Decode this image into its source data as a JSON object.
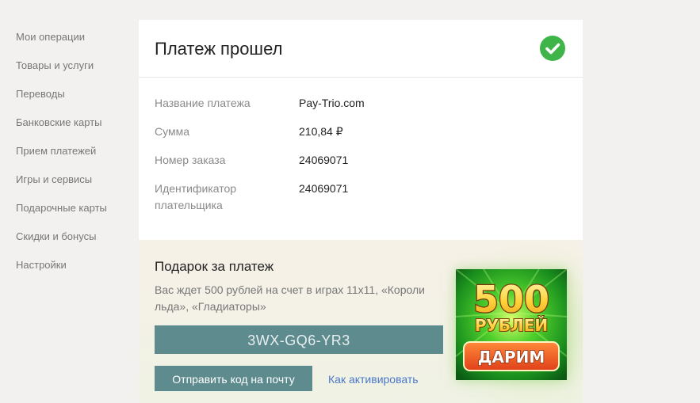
{
  "sidebar": {
    "items": [
      {
        "label": "Мои операции"
      },
      {
        "label": "Товары и услуги"
      },
      {
        "label": "Переводы"
      },
      {
        "label": "Банковские карты"
      },
      {
        "label": "Прием платежей"
      },
      {
        "label": "Игры и сервисы"
      },
      {
        "label": "Подарочные карты"
      },
      {
        "label": "Скидки и бонусы"
      },
      {
        "label": "Настройки"
      }
    ]
  },
  "payment": {
    "title": "Платеж прошел",
    "status_icon": "check-icon",
    "status_color": "#3fb549",
    "rows": [
      {
        "label": "Название платежа",
        "value": "Pay-Trio.com"
      },
      {
        "label": "Сумма",
        "value": "210,84 ₽"
      },
      {
        "label": "Номер заказа",
        "value": "24069071"
      },
      {
        "label": "Идентификатор плательщика",
        "value": "24069071"
      }
    ]
  },
  "gift": {
    "title": "Подарок за платеж",
    "description": "Вас ждет 500 рублей на счет в играх 11x11, «Короли льда», «Гладиаторы»",
    "code": "3WX-GQ6-YR3",
    "send_button_label": "Отправить код на почту",
    "activate_link_label": "Как активировать",
    "accent_color": "#5d8b8e",
    "banner": {
      "amount": "500",
      "currency": "РУБЛЕЙ",
      "cta": "ДАРИМ"
    }
  }
}
